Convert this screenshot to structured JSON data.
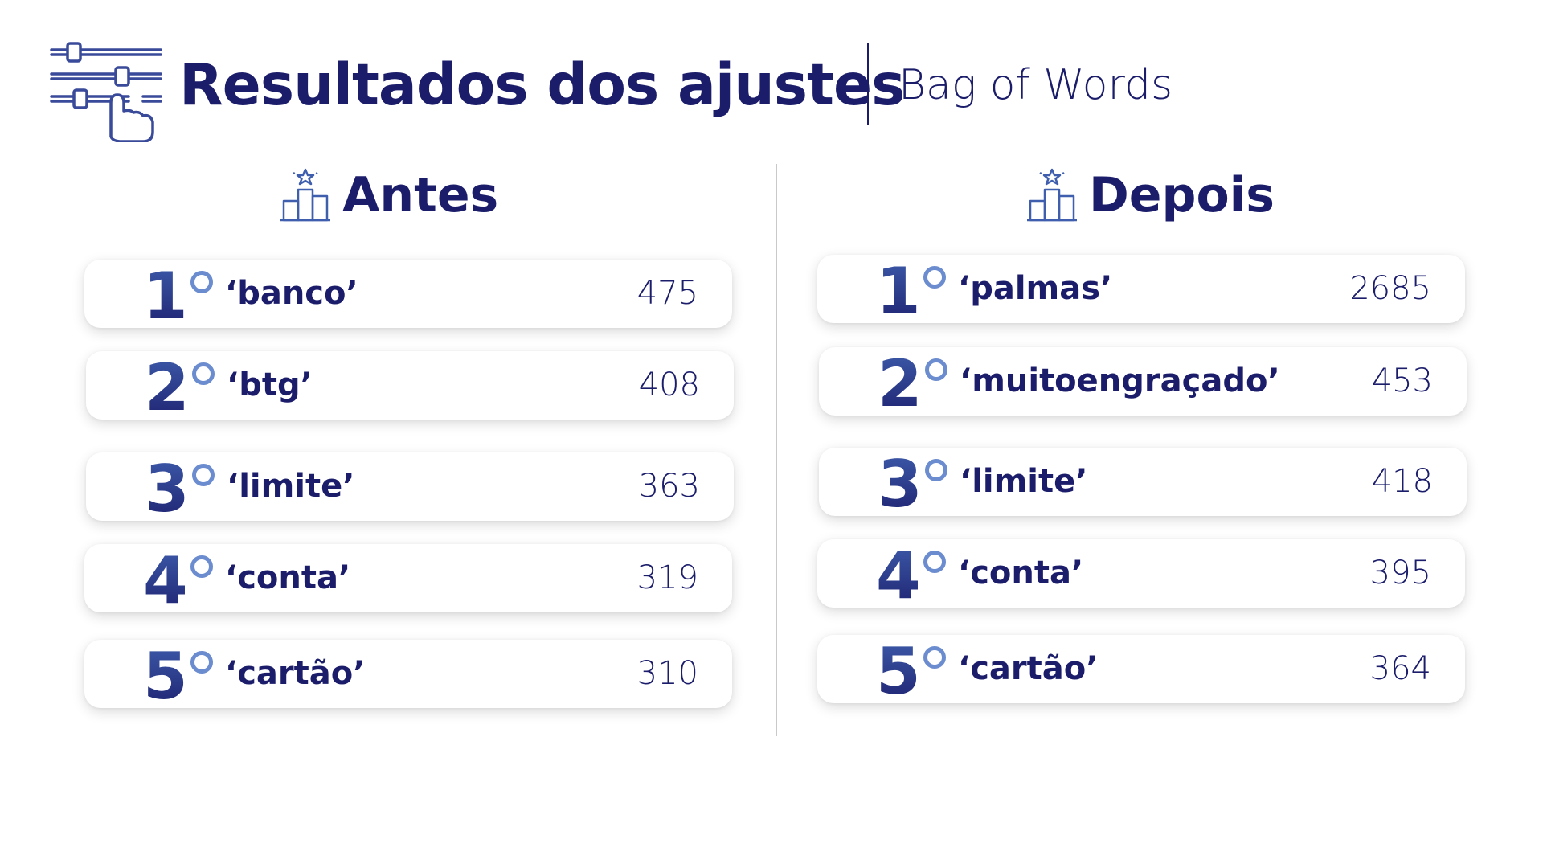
{
  "header": {
    "title": "Resultados dos ajustes",
    "subtitle": "Bag of Words",
    "icon": "sliders-hand-icon"
  },
  "colors": {
    "navy": "#1b1d6b",
    "accent_blue": "#6b8ccf",
    "divider": "#c9c9c9"
  },
  "before": {
    "heading": "Antes",
    "icon": "podium-star-icon",
    "rows": [
      {
        "rank": "1",
        "word": "‘banco’",
        "count": "475"
      },
      {
        "rank": "2",
        "word": "‘btg’",
        "count": "408"
      },
      {
        "rank": "3",
        "word": "‘limite’",
        "count": "363"
      },
      {
        "rank": "4",
        "word": "‘conta’",
        "count": "319"
      },
      {
        "rank": "5",
        "word": "‘cartão’",
        "count": "310"
      }
    ]
  },
  "after": {
    "heading": "Depois",
    "icon": "podium-star-icon",
    "rows": [
      {
        "rank": "1",
        "word": "‘palmas’",
        "count": "2685"
      },
      {
        "rank": "2",
        "word": "‘muitoengraçado’",
        "count": "453"
      },
      {
        "rank": "3",
        "word": "‘limite’",
        "count": "418"
      },
      {
        "rank": "4",
        "word": "‘conta’",
        "count": "395"
      },
      {
        "rank": "5",
        "word": "‘cartão’",
        "count": "364"
      }
    ]
  }
}
